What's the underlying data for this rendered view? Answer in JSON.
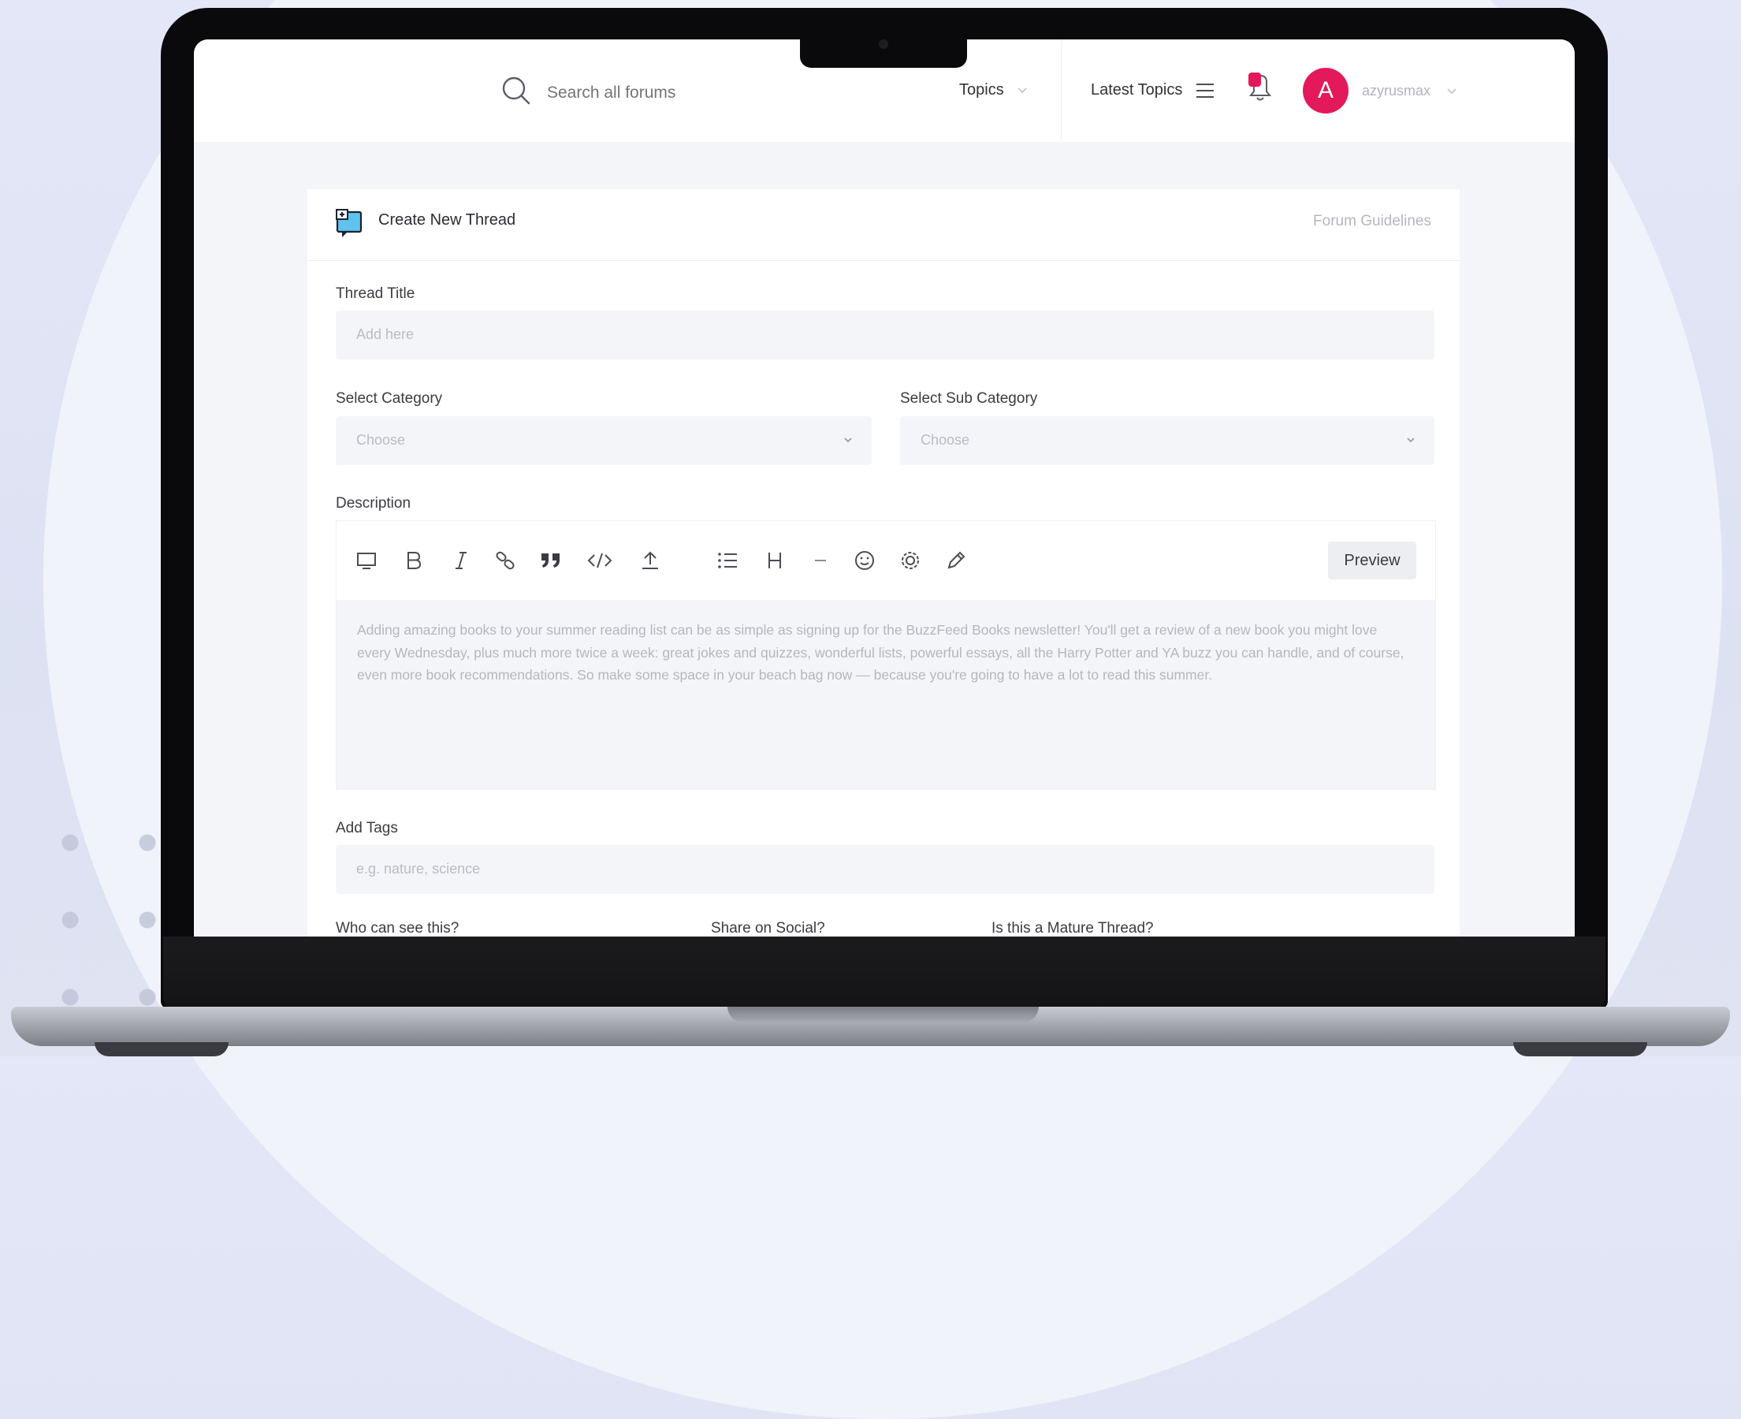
{
  "header": {
    "search_placeholder": "Search all forums",
    "topics_label": "Topics",
    "latest_topics_label": "Latest Topics",
    "avatar_initial": "A",
    "username": "azyrusmax"
  },
  "card": {
    "title": "Create New Thread",
    "guidelines_link": "Forum Guidelines",
    "thread_title_label": "Thread Title",
    "thread_title_placeholder": "Add here",
    "category_label": "Select Category",
    "category_value": "Choose",
    "subcategory_label": "Select Sub Category",
    "subcategory_value": "Choose",
    "description_label": "Description",
    "preview_label": "Preview",
    "description_text": "Adding amazing books to your summer reading list can be as simple as signing up for the BuzzFeed Books newsletter! You'll get a review of a new book you might love every Wednesday, plus much more twice a week: great jokes and quizzes, wonderful lists, powerful essays, all the Harry Potter and YA buzz you can handle, and of course, even more book recommendations. So make some space in your beach bag now — because you're going to have a lot to read this summer.",
    "tags_label": "Add Tags",
    "tags_placeholder": "e.g. nature, science",
    "visibility_label": "Who can see this?",
    "share_label": "Share on Social?",
    "mature_label": "Is this a Mature Thread?"
  },
  "toolbar_icons": [
    "square-icon",
    "bold-icon",
    "italic-icon",
    "link-icon",
    "quote-icon",
    "code-icon",
    "upload-icon",
    "list-icon",
    "heading-icon",
    "hr-icon",
    "emoji-icon",
    "settings-icon",
    "pen-icon"
  ],
  "colors": {
    "accent": "#e3195c",
    "brand_icon": "#2d9fd9"
  }
}
